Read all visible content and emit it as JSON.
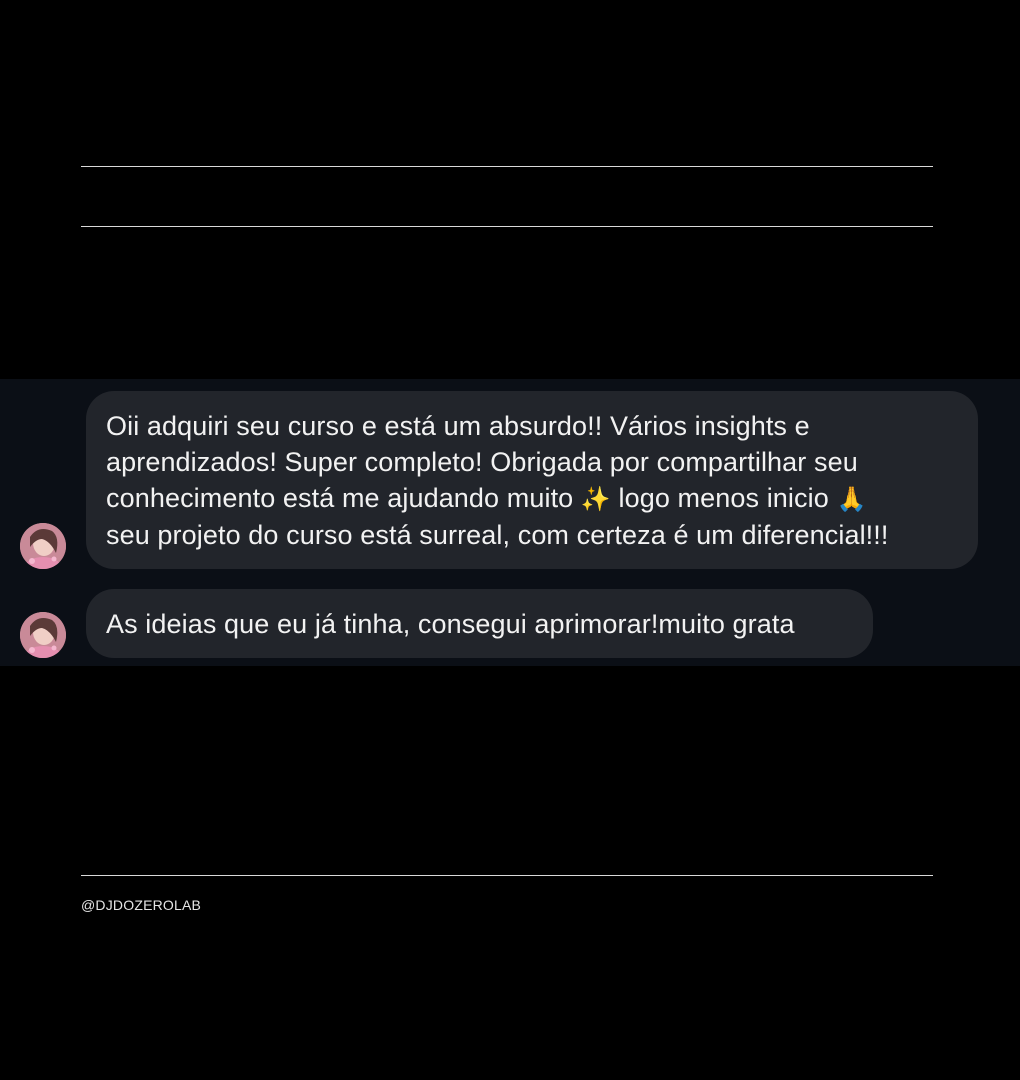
{
  "messages": [
    {
      "lines": [
        "Oii adquiri seu curso e está um absurdo!! Vários insights e",
        "aprendizados! Super completo! Obrigada por compartilhar seu",
        "conhecimento está me ajudando muito",
        "logo menos inicio",
        "seu projeto do curso está surreal, com certeza é um diferencial!!!"
      ],
      "emoji_sparkles": "✨",
      "emoji_pray": "🙏"
    },
    {
      "text": "As ideias que eu já tinha, consegui aprimorar!muito grata"
    }
  ],
  "footer": {
    "handle": "@DJDOZEROLAB"
  },
  "colors": {
    "background": "#000000",
    "chat_panel": "#0b0f16",
    "bubble": "#22252b",
    "text": "#f2f2f2"
  },
  "icons": {
    "avatar": "user-avatar-photo",
    "sparkles": "sparkles-emoji",
    "pray": "folded-hands-emoji"
  }
}
